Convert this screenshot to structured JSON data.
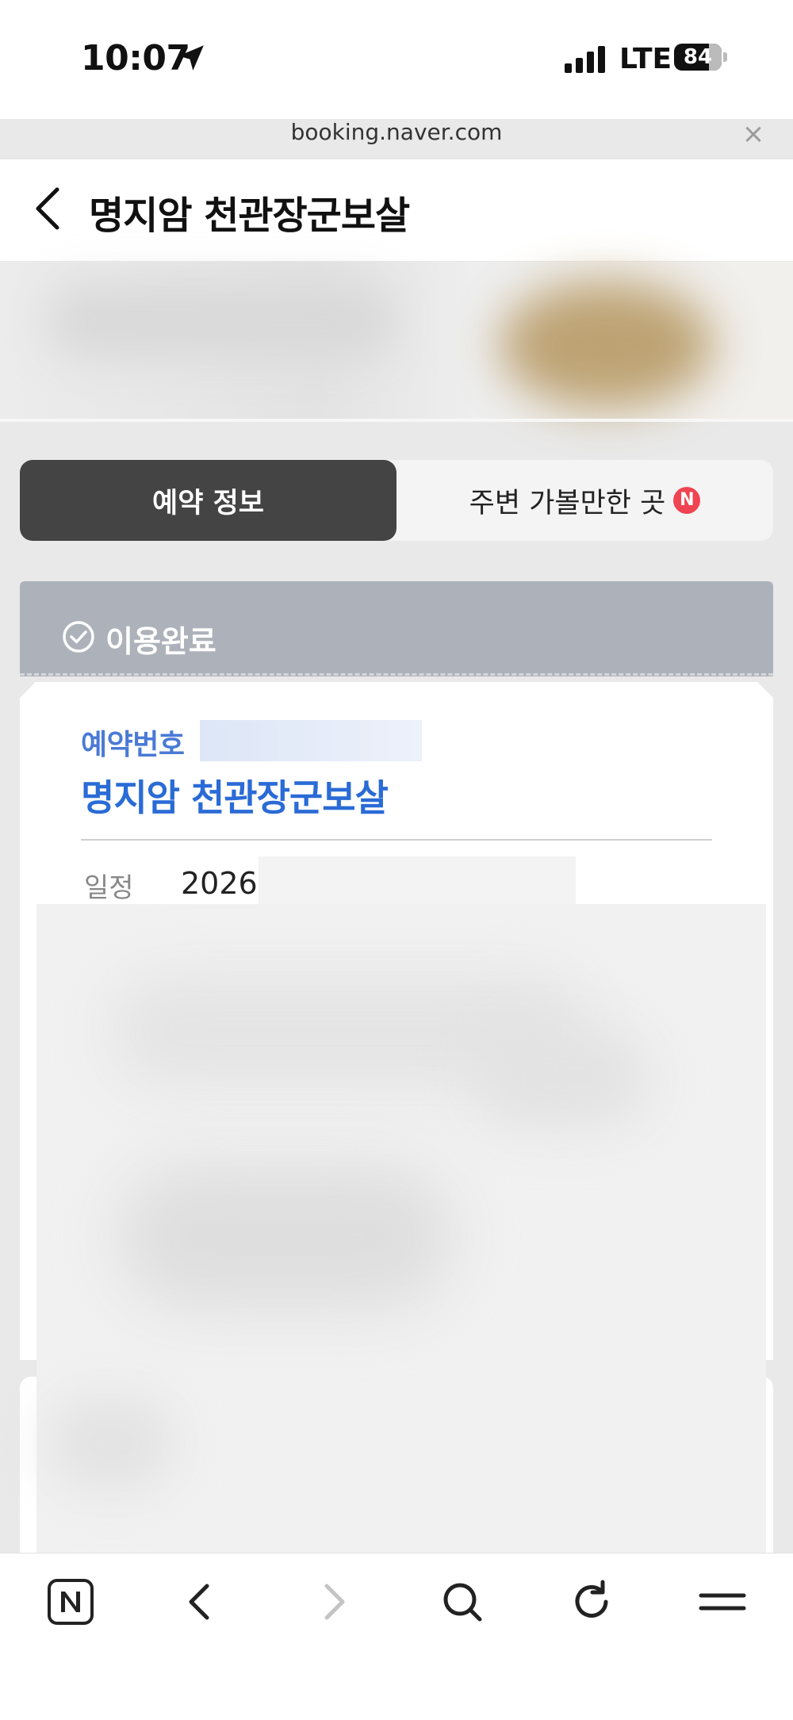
{
  "status_bar": {
    "time": "10:07",
    "network": "LTE",
    "battery": "84",
    "location_icon": "location-arrow-icon",
    "signal_icon": "cellular-signal-icon"
  },
  "browser": {
    "url": "booking.naver.com",
    "close_symbol": "×"
  },
  "header": {
    "title": "명지암 천관장군보살",
    "back_icon": "chevron-left-icon"
  },
  "tabs": [
    {
      "label": "예약 정보",
      "active": true
    },
    {
      "label": "주변 가볼만한 곳",
      "active": false,
      "badge": "N"
    }
  ],
  "booking_status": {
    "label": "이용완료",
    "icon": "check-circle-icon"
  },
  "card": {
    "reservation_label": "예약번호",
    "place_name": "명지암 천관장군보살",
    "schedule_label": "일정",
    "schedule_value": "2026."
  },
  "toolbar": {
    "items": [
      "naver-home-icon",
      "back-arrow-icon",
      "forward-arrow-icon",
      "search-icon",
      "refresh-icon",
      "menu-icon"
    ]
  },
  "colors": {
    "accent_blue": "#2a6bd6",
    "tab_active_bg": "#444444",
    "status_strip": "#adb2ba",
    "badge_red": "#f04452"
  }
}
